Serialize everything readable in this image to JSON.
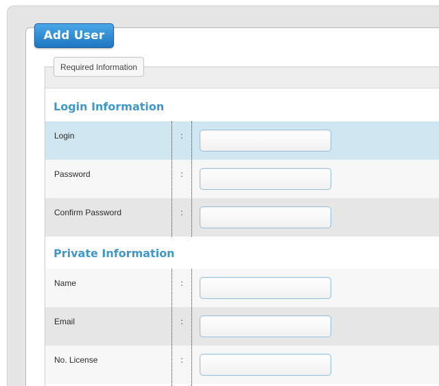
{
  "dialog": {
    "title": "Add User"
  },
  "fieldset": {
    "legend": "Required Information"
  },
  "sections": [
    {
      "title": "Login Information",
      "fields": [
        {
          "label": "Login",
          "separator": ":",
          "value": ""
        },
        {
          "label": "Password",
          "separator": ":",
          "value": ""
        },
        {
          "label": "Confirm Password",
          "separator": ":",
          "value": ""
        }
      ]
    },
    {
      "title": "Private Information",
      "fields": [
        {
          "label": "Name",
          "separator": ":",
          "value": ""
        },
        {
          "label": "Email",
          "separator": ":",
          "value": ""
        },
        {
          "label": "No. License",
          "separator": ":",
          "value": ""
        }
      ]
    }
  ],
  "colors": {
    "accent_blue": "#3f97cc",
    "title_button": "#1e77c2",
    "row_highlight": "#d0e6f0"
  }
}
